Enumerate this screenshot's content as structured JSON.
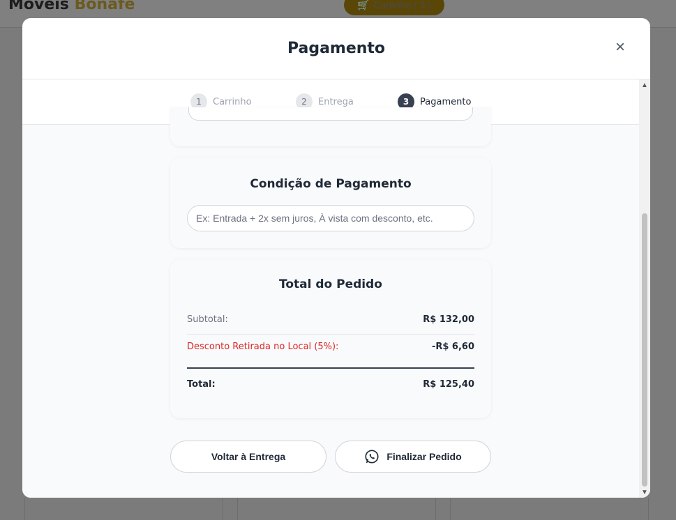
{
  "background": {
    "logo_main": "Moveis",
    "logo_accent": "Bonafé",
    "cart_label": "Carrinho ( 3 )"
  },
  "modal": {
    "title": "Pagamento",
    "close_icon": "×"
  },
  "steps": [
    {
      "number": "1",
      "label": "Carrinho",
      "active": false
    },
    {
      "number": "2",
      "label": "Entrega",
      "active": false
    },
    {
      "number": "3",
      "label": "Pagamento",
      "active": true
    }
  ],
  "payment_condition": {
    "title": "Condição de Pagamento",
    "placeholder": "Ex: Entrada + 2x sem juros, À vista com desconto, etc.",
    "value": ""
  },
  "order_total": {
    "title": "Total do Pedido",
    "subtotal_label": "Subtotal:",
    "subtotal_value": "R$ 132,00",
    "discount_label": "Desconto Retirada no Local (5%):",
    "discount_value": "-R$ 6,60",
    "total_label": "Total:",
    "total_value": "R$ 125,40"
  },
  "actions": {
    "back_label": "Voltar à Entrega",
    "finish_label": "Finalizar Pedido",
    "finish_icon": "whatsapp-icon"
  },
  "colors": {
    "discount": "#dc2626",
    "active_step": "#374151"
  }
}
